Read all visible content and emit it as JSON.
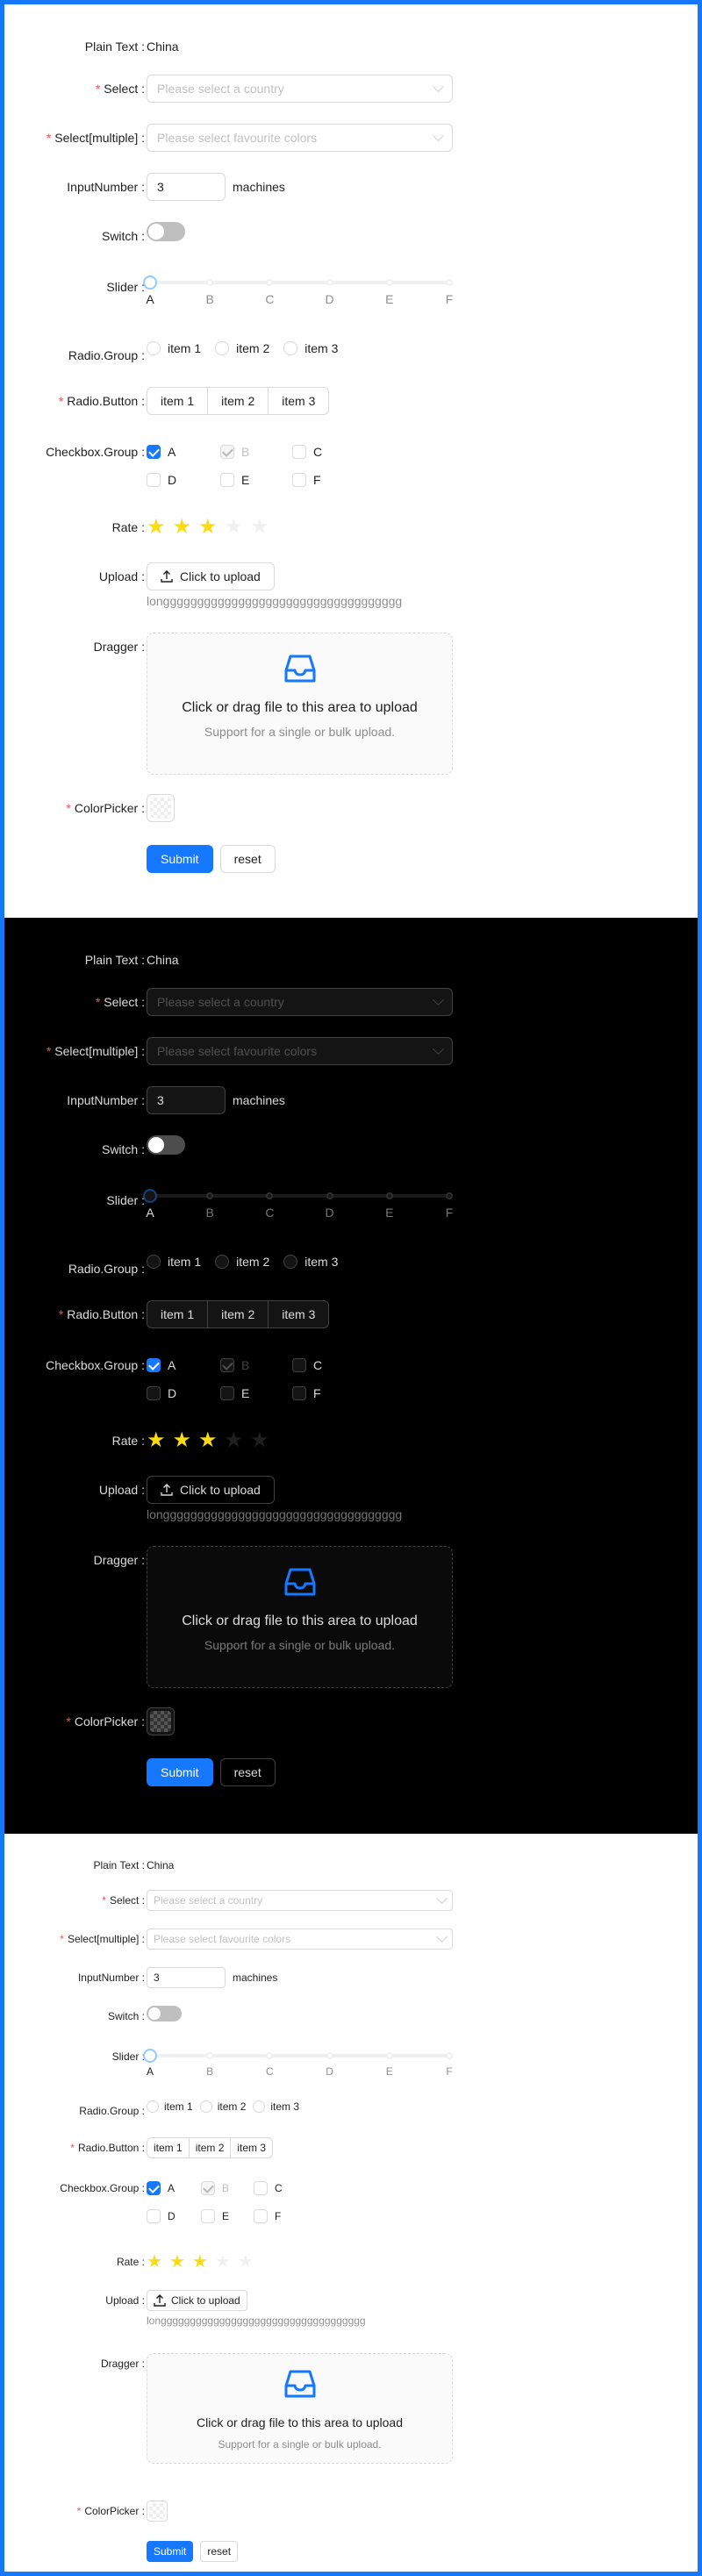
{
  "form": {
    "plain_text_label": "Plain Text",
    "plain_text_value": "China",
    "select_label": "Select",
    "select_placeholder": "Please select a country",
    "select_multiple_label": "Select[multiple]",
    "select_multiple_placeholder": "Please select favourite colors",
    "input_number_label": "InputNumber",
    "input_number_value": "3",
    "input_number_suffix": "machines",
    "switch_label": "Switch",
    "switch_on": false,
    "slider_label": "Slider",
    "slider_marks": [
      "A",
      "B",
      "C",
      "D",
      "E",
      "F"
    ],
    "slider_value": 0,
    "radio_group_label": "Radio.Group",
    "radio_group_items": [
      "item 1",
      "item 2",
      "item 3"
    ],
    "radio_button_label": "Radio.Button",
    "radio_button_items": [
      "item 1",
      "item 2",
      "item 3"
    ],
    "checkbox_group_label": "Checkbox.Group",
    "checkbox_items": [
      {
        "label": "A",
        "checked": true,
        "disabled": false
      },
      {
        "label": "B",
        "checked": true,
        "disabled": true
      },
      {
        "label": "C",
        "checked": false,
        "disabled": false
      },
      {
        "label": "D",
        "checked": false,
        "disabled": false
      },
      {
        "label": "E",
        "checked": false,
        "disabled": false
      },
      {
        "label": "F",
        "checked": false,
        "disabled": false
      }
    ],
    "rate_label": "Rate",
    "rate_value": 3,
    "rate_max": 5,
    "upload_label": "Upload",
    "upload_button": "Click to upload",
    "upload_filename": "longgggggggggggggggggggggggggggggggggg",
    "dragger_label": "Dragger",
    "dragger_title": "Click or drag file to this area to upload",
    "dragger_hint": "Support for a single or bulk upload.",
    "colorpicker_label": "ColorPicker",
    "submit_button": "Submit",
    "reset_button": "reset"
  },
  "colors": {
    "primary": "#1677ff",
    "required": "#ff4d4f",
    "star": "#fadb14",
    "frame": "#1677ff"
  }
}
